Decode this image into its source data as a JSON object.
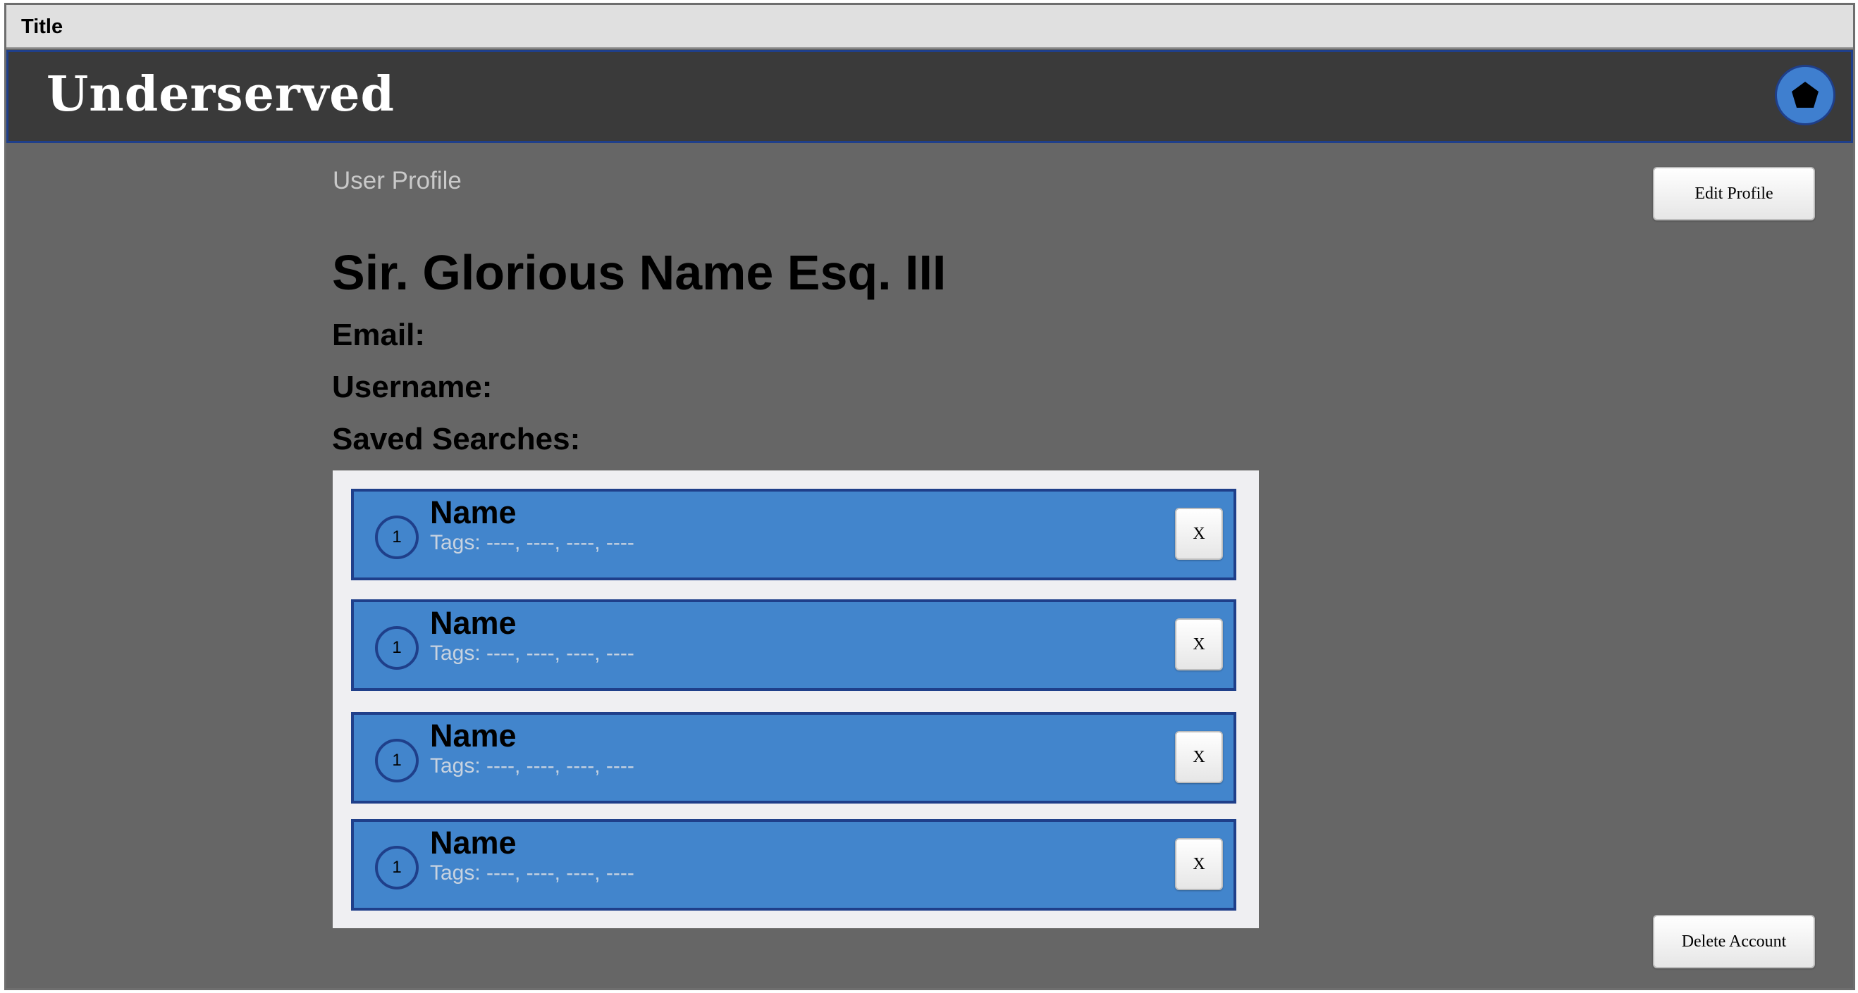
{
  "window": {
    "title": "Title"
  },
  "header": {
    "brand": "Underserved",
    "profile_icon": "pentagon-icon"
  },
  "main": {
    "section_label": "User Profile",
    "edit_profile_label": "Edit Profile",
    "user_name": "Sir. Glorious Name Esq. III",
    "email_label": "Email:",
    "username_label": "Username:",
    "saved_searches_label": "Saved Searches:",
    "delete_account_label": "Delete Account"
  },
  "saved_searches": [
    {
      "number": "1",
      "name": "Name",
      "tags": "Tags: ----, ----, ----, ----",
      "remove_label": "X"
    },
    {
      "number": "1",
      "name": "Name",
      "tags": "Tags: ----, ----, ----, ----",
      "remove_label": "X"
    },
    {
      "number": "1",
      "name": "Name",
      "tags": "Tags: ----, ----, ----, ----",
      "remove_label": "X"
    },
    {
      "number": "1",
      "name": "Name",
      "tags": "Tags: ----, ----, ----, ----",
      "remove_label": "X"
    }
  ],
  "colors": {
    "background": "#666666",
    "header": "#3a3a3a",
    "accent": "#4285cc",
    "border": "#1f3f8a",
    "panel": "#efeff2"
  }
}
